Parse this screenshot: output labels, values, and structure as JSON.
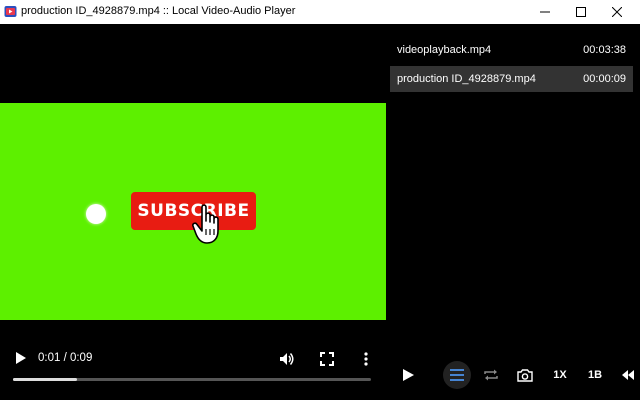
{
  "window": {
    "title": "production ID_4928879.mp4 :: Local Video-Audio Player"
  },
  "video": {
    "subscribe_label": "SUBSCRIBE",
    "background_color": "#5df000",
    "time_display": "0:01 / 0:09",
    "progress": 0.18
  },
  "playlist": {
    "items": [
      {
        "name": "videoplayback.mp4",
        "duration": "00:03:38",
        "active": false
      },
      {
        "name": "production ID_4928879.mp4",
        "duration": "00:00:09",
        "active": true
      }
    ]
  },
  "toolbar": {
    "speed_label": "1X",
    "b_label": "1B"
  },
  "colors": {
    "accent": "#4a8fe7",
    "subscribe_red": "#e81c12"
  }
}
